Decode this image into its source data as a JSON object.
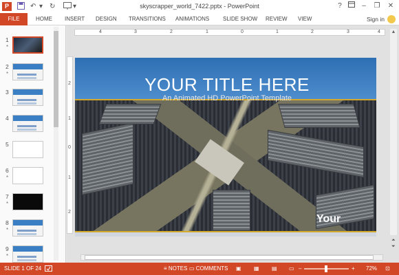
{
  "app": {
    "logo": "P",
    "window_title": "skyscrapper_world_7422.pptx - PowerPoint"
  },
  "qat": {
    "save_icon": "save-icon",
    "undo_icon": "undo-icon",
    "redo_icon": "redo-icon"
  },
  "window_buttons": {
    "help": "?",
    "minimize": "–",
    "restore": "❐",
    "close": "✕"
  },
  "ribbon": {
    "file": "FILE",
    "tabs": [
      "HOME",
      "INSERT",
      "DESIGN",
      "TRANSITIONS",
      "ANIMATIONS",
      "SLIDE SHOW",
      "REVIEW",
      "VIEW"
    ],
    "signin": "Sign in"
  },
  "thumbnails": [
    {
      "num": "1",
      "star": "*"
    },
    {
      "num": "2",
      "star": "*"
    },
    {
      "num": "3",
      "star": ""
    },
    {
      "num": "4",
      "star": ""
    },
    {
      "num": "5",
      "star": ""
    },
    {
      "num": "6",
      "star": "*"
    },
    {
      "num": "7",
      "star": "*"
    },
    {
      "num": "8",
      "star": "*"
    },
    {
      "num": "9",
      "star": "*"
    }
  ],
  "ruler": {
    "h": [
      "4",
      "3",
      "2",
      "1",
      "0",
      "1",
      "2",
      "3",
      "4"
    ],
    "v": [
      "2",
      "1",
      "0",
      "1",
      "2"
    ]
  },
  "slide": {
    "title": "YOUR TITLE HERE",
    "subtitle": "An Animated HD PowerPoint Template",
    "brand": "Your"
  },
  "statusbar": {
    "slide_info": "SLIDE 1 OF 24",
    "notes": "NOTES",
    "comments": "COMMENTS",
    "zoom": "72%"
  }
}
